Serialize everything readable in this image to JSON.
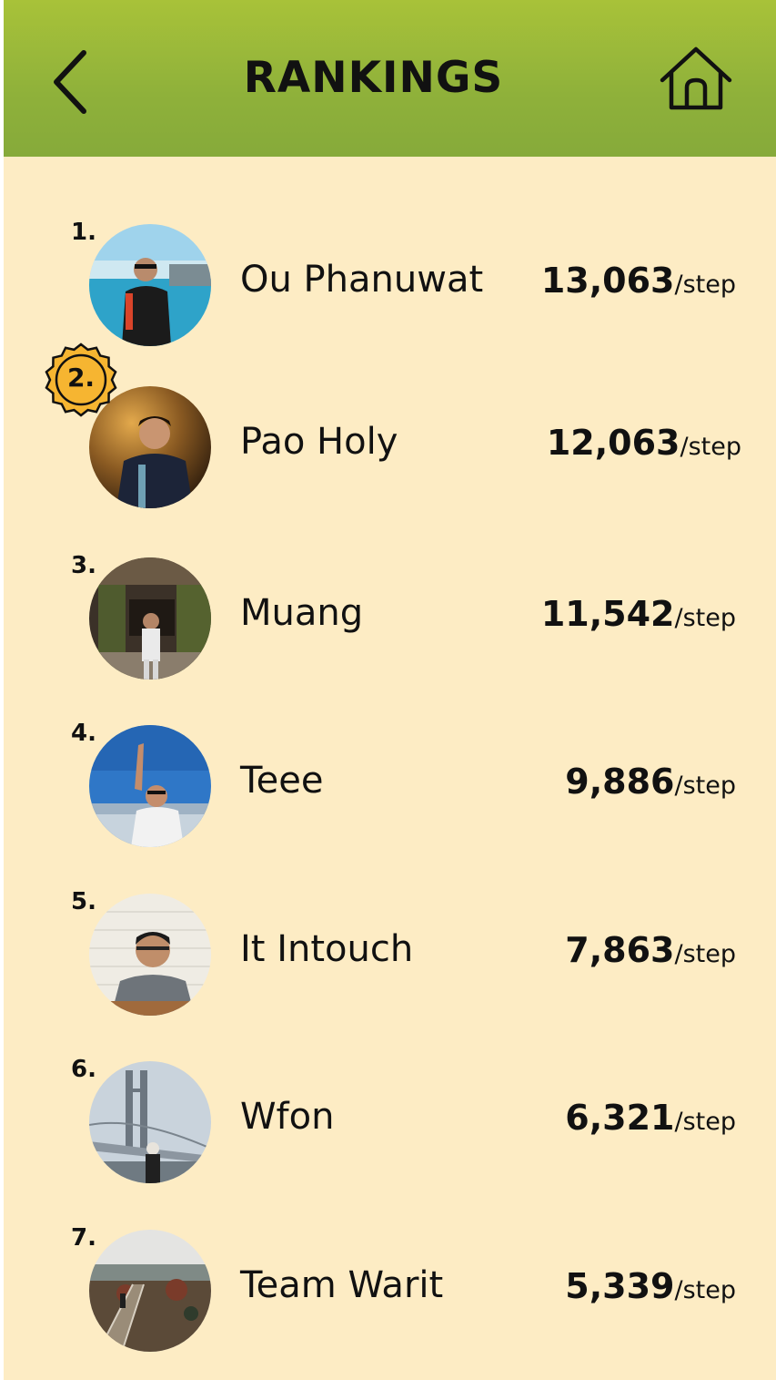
{
  "header": {
    "title": "RANKINGS",
    "back_icon": "chevron-left-icon",
    "home_icon": "home-icon",
    "colors": {
      "top": "#a8c239",
      "bottom": "#86aa3a"
    }
  },
  "background_color": "#fdecc4",
  "rankings": [
    {
      "rank": "1.",
      "name": "Ou Phanuwat",
      "steps": "13,063",
      "unit": "/step",
      "highlighted": false
    },
    {
      "rank": "2.",
      "name": "Pao Holy",
      "steps": "12,063",
      "unit": "/step",
      "highlighted": true
    },
    {
      "rank": "3.",
      "name": "Muang",
      "steps": "11,542",
      "unit": "/step",
      "highlighted": false
    },
    {
      "rank": "4.",
      "name": "Teee",
      "steps": "9,886",
      "unit": "/step",
      "highlighted": false
    },
    {
      "rank": "5.",
      "name": "It Intouch",
      "steps": "7,863",
      "unit": "/step",
      "highlighted": false
    },
    {
      "rank": "6.",
      "name": "Wfon",
      "steps": "6,321",
      "unit": "/step",
      "highlighted": false
    },
    {
      "rank": "7.",
      "name": "Team Warit",
      "steps": "5,339",
      "unit": "/step",
      "highlighted": false
    }
  ],
  "badge_color": "#f6b531"
}
